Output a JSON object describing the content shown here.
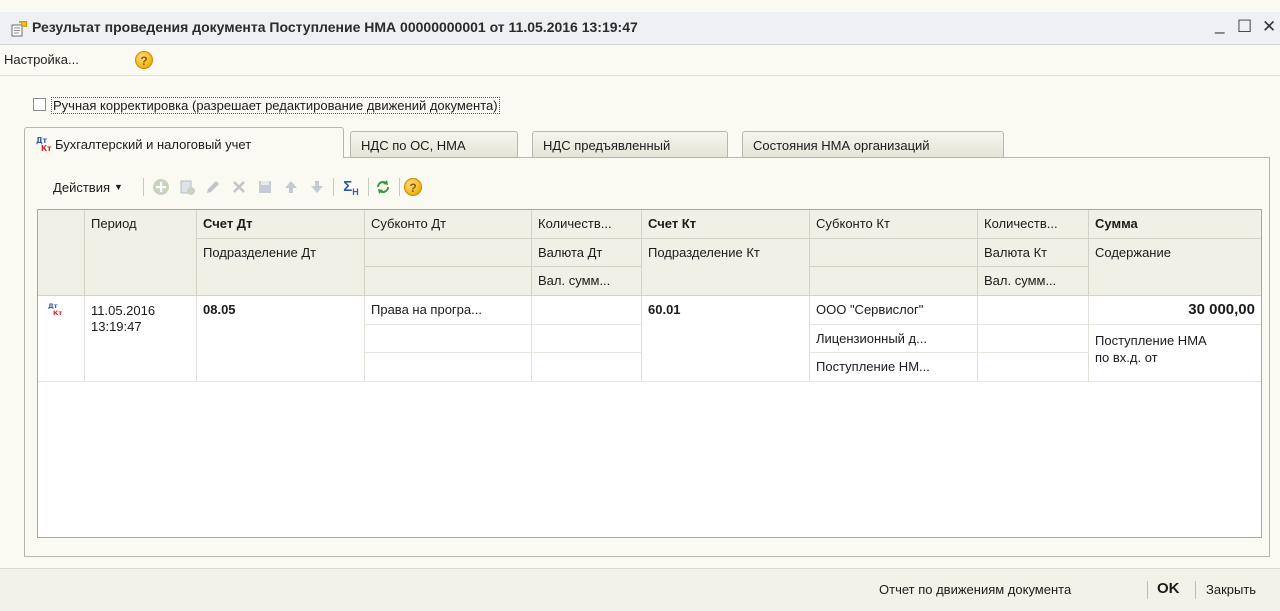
{
  "window": {
    "title": "Результат проведения документа Поступление НМА 00000000001 от 11.05.2016 13:19:47",
    "minimize": "_",
    "maximize": "☐",
    "close": "✕"
  },
  "menu": {
    "settings_label": "Настройка...",
    "help_icon": "?"
  },
  "manual_edit": {
    "checked": false,
    "label": "Ручная корректировка (разрешает редактирование движений документа)"
  },
  "tabs": [
    {
      "label": "Бухгалтерский и налоговый учет",
      "active": true,
      "icon": "dt-kt-icon"
    },
    {
      "label": "НДС по ОС, НМА",
      "active": false
    },
    {
      "label": "НДС предъявленный",
      "active": false
    },
    {
      "label": "Состояния НМА организаций",
      "active": false
    }
  ],
  "toolbar": {
    "actions_label": "Действия",
    "icons": [
      "add-icon",
      "copy-icon",
      "edit-icon",
      "delete-icon",
      "save-icon",
      "move-up-icon",
      "move-down-icon",
      "sum-icon",
      "refresh-icon",
      "help-icon"
    ],
    "sum_label": "Σ",
    "sum_sub": "H",
    "help_icon": "?"
  },
  "grid": {
    "headers": {
      "period": "Период",
      "dt_account": "Счет Дт",
      "dt_subconto": "Субконто Дт",
      "dt_qty": "Количеств...",
      "kt_account": "Счет Кт",
      "kt_subconto": "Субконто Кт",
      "kt_qty": "Количеств...",
      "amount": "Сумма",
      "dt_division": "Подразделение Дт",
      "dt_currency": "Валюта Дт",
      "kt_division": "Подразделение Кт",
      "kt_currency": "Валюта Кт",
      "content": "Содержание",
      "dt_cur_amount": "Вал. сумм...",
      "kt_cur_amount": "Вал. сумм..."
    },
    "rows": [
      {
        "icon": "dt-kt-icon",
        "period_date": "11.05.2016",
        "period_time": "13:19:47",
        "dt_account": "08.05",
        "dt_subconto1": "Права на програ...",
        "kt_account": "60.01",
        "kt_subconto1": "ООО \"Сервислог\"",
        "kt_subconto2": "Лицензионный д...",
        "kt_subconto3": "Поступление НМ...",
        "amount": "30 000,00",
        "content_line1": "Поступление НМА",
        "content_line2": "по вх.д. от"
      }
    ]
  },
  "status": {
    "report_label": "Отчет по движениям документа",
    "ok_label": "OK",
    "close_label": "Закрыть"
  },
  "colors": {
    "window_bg": "#fbfaf2",
    "header_bg": "#f1f0e6",
    "dt_color": "#2e5da8",
    "kt_color": "#d1262b"
  }
}
